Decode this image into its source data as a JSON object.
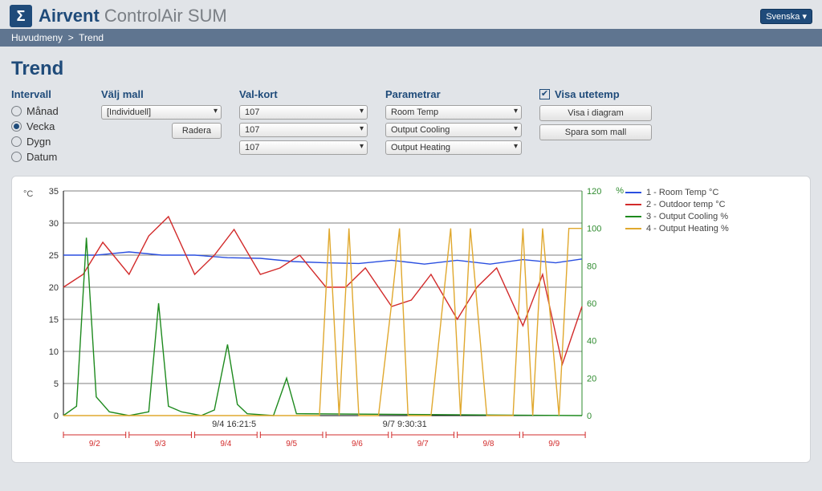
{
  "brand": {
    "bold": "Airvent",
    "light": "ControlAir SUM"
  },
  "language": "Svenska",
  "breadcrumb": {
    "home": "Huvudmeny",
    "sep": ">",
    "current": "Trend"
  },
  "page_title": "Trend",
  "intervals": {
    "label": "Intervall",
    "options": [
      {
        "label": "Månad",
        "checked": false
      },
      {
        "label": "Vecka",
        "checked": true
      },
      {
        "label": "Dygn",
        "checked": false
      },
      {
        "label": "Datum",
        "checked": false
      }
    ]
  },
  "template_col": {
    "label": "Välj mall",
    "select": "[Individuell]",
    "delete_btn": "Radera"
  },
  "card_col": {
    "label": "Val-kort",
    "selects": [
      "107",
      "107",
      "107"
    ]
  },
  "param_col": {
    "label": "Parametrar",
    "selects": [
      "Room Temp",
      "Output Cooling",
      "Output Heating"
    ]
  },
  "right_col": {
    "show_outdoor": "Visa utetemp",
    "show_chart": "Visa i diagram",
    "save_template": "Spara som mall"
  },
  "chart_data": {
    "type": "line",
    "left_axis": {
      "unit": "°C",
      "min": 0,
      "max": 35,
      "ticks": [
        0,
        5,
        10,
        15,
        20,
        25,
        30,
        35
      ]
    },
    "right_axis": {
      "unit": "%",
      "min": 0,
      "max": 120,
      "ticks": [
        0,
        20,
        40,
        60,
        80,
        100,
        120
      ]
    },
    "x_labels": [
      "9/2",
      "9/3",
      "9/4",
      "9/5",
      "9/6",
      "9/7",
      "9/8",
      "9/9"
    ],
    "x_annotations": [
      "9/4 16:21:5",
      "9/7 9:30:31"
    ],
    "legend": [
      {
        "name": "1 - Room Temp °C",
        "color": "#2a4fe0"
      },
      {
        "name": "2 - Outdoor temp °C",
        "color": "#d22b2b"
      },
      {
        "name": "3 - Output Cooling %",
        "color": "#1e8a1e"
      },
      {
        "name": "4 - Output Heating %",
        "color": "#e0a82e"
      }
    ],
    "series": [
      {
        "name": "Room Temp °C",
        "color": "#2a4fe0",
        "axis": "left",
        "x": [
          0,
          0.5,
          1,
          1.5,
          2,
          2.5,
          3,
          3.5,
          4,
          4.5,
          5,
          5.5,
          6,
          6.5,
          7,
          7.5,
          7.9
        ],
        "y": [
          25,
          25,
          25.5,
          25,
          25,
          24.6,
          24.5,
          24,
          23.8,
          23.7,
          24.2,
          23.6,
          24.2,
          23.6,
          24.3,
          23.8,
          24.4
        ]
      },
      {
        "name": "Outdoor temp °C",
        "color": "#d22b2b",
        "axis": "left",
        "x": [
          0,
          0.3,
          0.6,
          1,
          1.3,
          1.6,
          2,
          2.3,
          2.6,
          3,
          3.3,
          3.6,
          4,
          4.3,
          4.6,
          5,
          5.3,
          5.6,
          6,
          6.3,
          6.6,
          7,
          7.3,
          7.6,
          7.9
        ],
        "y": [
          20,
          22,
          27,
          22,
          28,
          31,
          22,
          25,
          29,
          22,
          23,
          25,
          20,
          20,
          23,
          17,
          18,
          22,
          15,
          20,
          23,
          14,
          22,
          8,
          17
        ]
      },
      {
        "name": "Output Cooling %",
        "color": "#1e8a1e",
        "axis": "right",
        "x": [
          0,
          0.2,
          0.35,
          0.5,
          0.7,
          1,
          1.3,
          1.45,
          1.6,
          1.8,
          2.1,
          2.3,
          2.5,
          2.65,
          2.8,
          3.2,
          3.4,
          3.55,
          7.9
        ],
        "y": [
          0,
          5,
          95,
          10,
          2,
          0,
          2,
          60,
          5,
          2,
          0,
          3,
          38,
          6,
          1,
          0,
          20,
          1,
          0
        ]
      },
      {
        "name": "Output Heating %",
        "color": "#e0a82e",
        "axis": "right",
        "x": [
          0,
          3.9,
          4.05,
          4.2,
          4.35,
          4.5,
          4.8,
          5,
          5.12,
          5.25,
          5.6,
          5.9,
          6.05,
          6.2,
          6.45,
          6.85,
          7.0,
          7.15,
          7.3,
          7.55,
          7.7,
          7.85,
          7.9
        ],
        "y": [
          0,
          0,
          100,
          0,
          100,
          0,
          0,
          60,
          100,
          0,
          0,
          100,
          0,
          100,
          0,
          0,
          100,
          0,
          100,
          0,
          100,
          100,
          100
        ]
      }
    ]
  }
}
